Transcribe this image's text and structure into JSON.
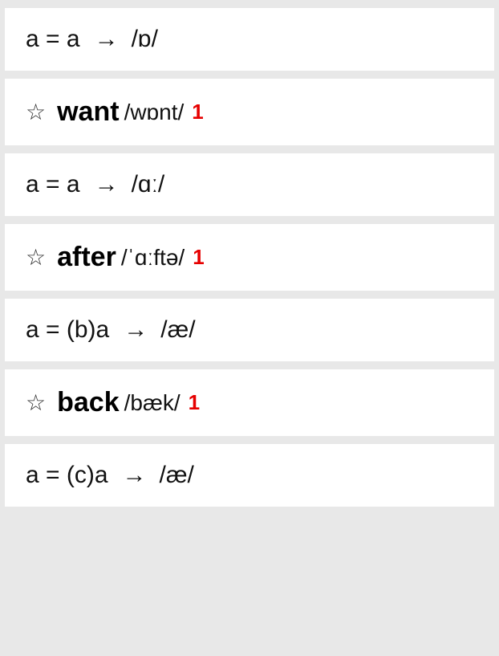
{
  "rows": [
    {
      "type": "rule",
      "left": "a = a",
      "arrow": "→",
      "phon": "/ɒ/"
    },
    {
      "type": "word",
      "star": "☆",
      "word": "want",
      "phon": "/wɒnt/",
      "num": "1"
    },
    {
      "type": "rule",
      "left": "a = a",
      "arrow": "→",
      "phon": "/ɑː/"
    },
    {
      "type": "word",
      "star": "☆",
      "word": "after",
      "phon": "/ˈɑːftə/",
      "num": "1"
    },
    {
      "type": "rule",
      "left": "a = (b)a",
      "arrow": "→",
      "phon": "/æ/"
    },
    {
      "type": "word",
      "star": "☆",
      "word": "back",
      "phon": "/bæk/",
      "num": "1"
    },
    {
      "type": "rule",
      "left": "a = (c)a",
      "arrow": "→",
      "phon": "/æ/"
    }
  ]
}
